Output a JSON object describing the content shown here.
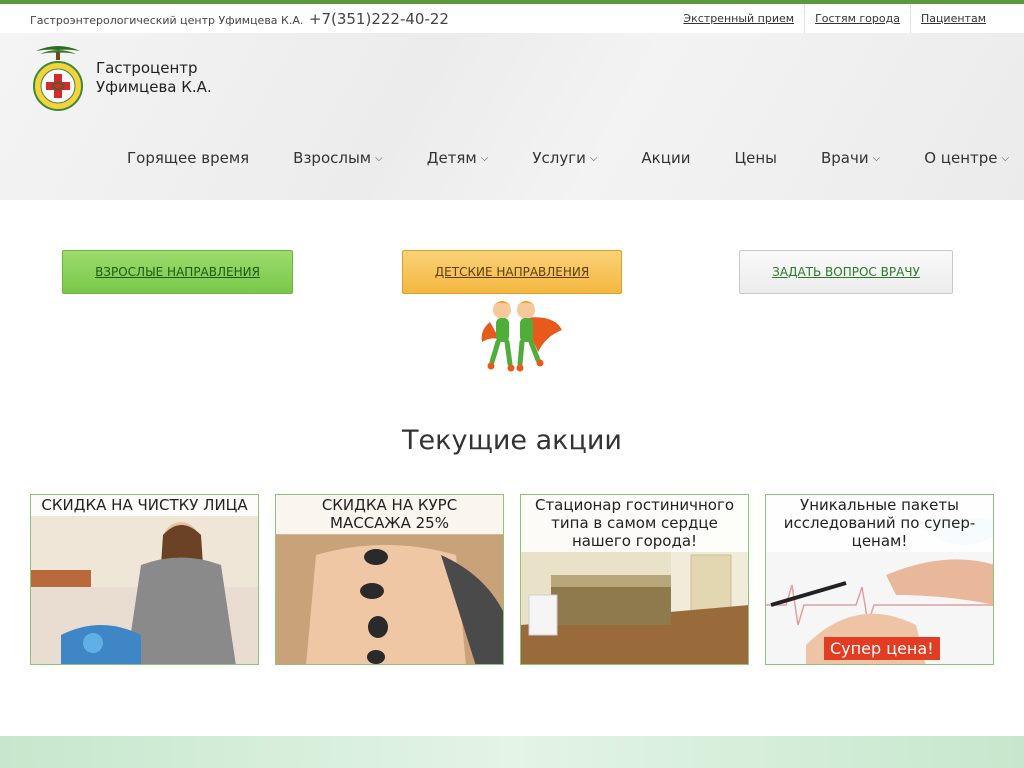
{
  "topbar": {
    "org_name": "Гастроэнтерологический центр Уфимцева К.А.",
    "phone": "+7(351)222-40-22",
    "links": [
      "Экстренный прием",
      "Гостям города",
      "Пациентам"
    ]
  },
  "brand": {
    "line1": "Гастроцентр",
    "line2": "Уфимцева К.А."
  },
  "nav": {
    "items": [
      {
        "label": "Горящее время",
        "dropdown": false
      },
      {
        "label": "Взрослым",
        "dropdown": true
      },
      {
        "label": "Детям",
        "dropdown": true
      },
      {
        "label": "Услуги",
        "dropdown": true
      },
      {
        "label": "Акции",
        "dropdown": false
      },
      {
        "label": "Цены",
        "dropdown": false
      },
      {
        "label": "Врачи",
        "dropdown": true
      },
      {
        "label": "О центре",
        "dropdown": true
      }
    ]
  },
  "buttons": {
    "adult": "ВЗРОСЛЫЕ НАПРАВЛЕНИЯ",
    "kids": "ДЕТСКИЕ НАПРАВЛЕНИЯ",
    "ask": "ЗАДАТЬ ВОПРОС ВРАЧУ"
  },
  "promos": {
    "title": "Текущие акции",
    "cards": [
      {
        "caption": "СКИДКА НА ЧИСТКУ ЛИЦА"
      },
      {
        "caption": "СКИДКА НА КУРС МАССАЖА 25%"
      },
      {
        "caption": "Стационар гостиничного типа в самом сердце нашего города!"
      },
      {
        "caption": "Уникальные пакеты исследований по супер-ценам!",
        "badge": "Супер цена!"
      }
    ]
  },
  "colors": {
    "accent_green": "#5a9a3a",
    "adult_button": "#79c84a",
    "kids_button": "#f3b73f",
    "badge_red": "#e23c22"
  }
}
